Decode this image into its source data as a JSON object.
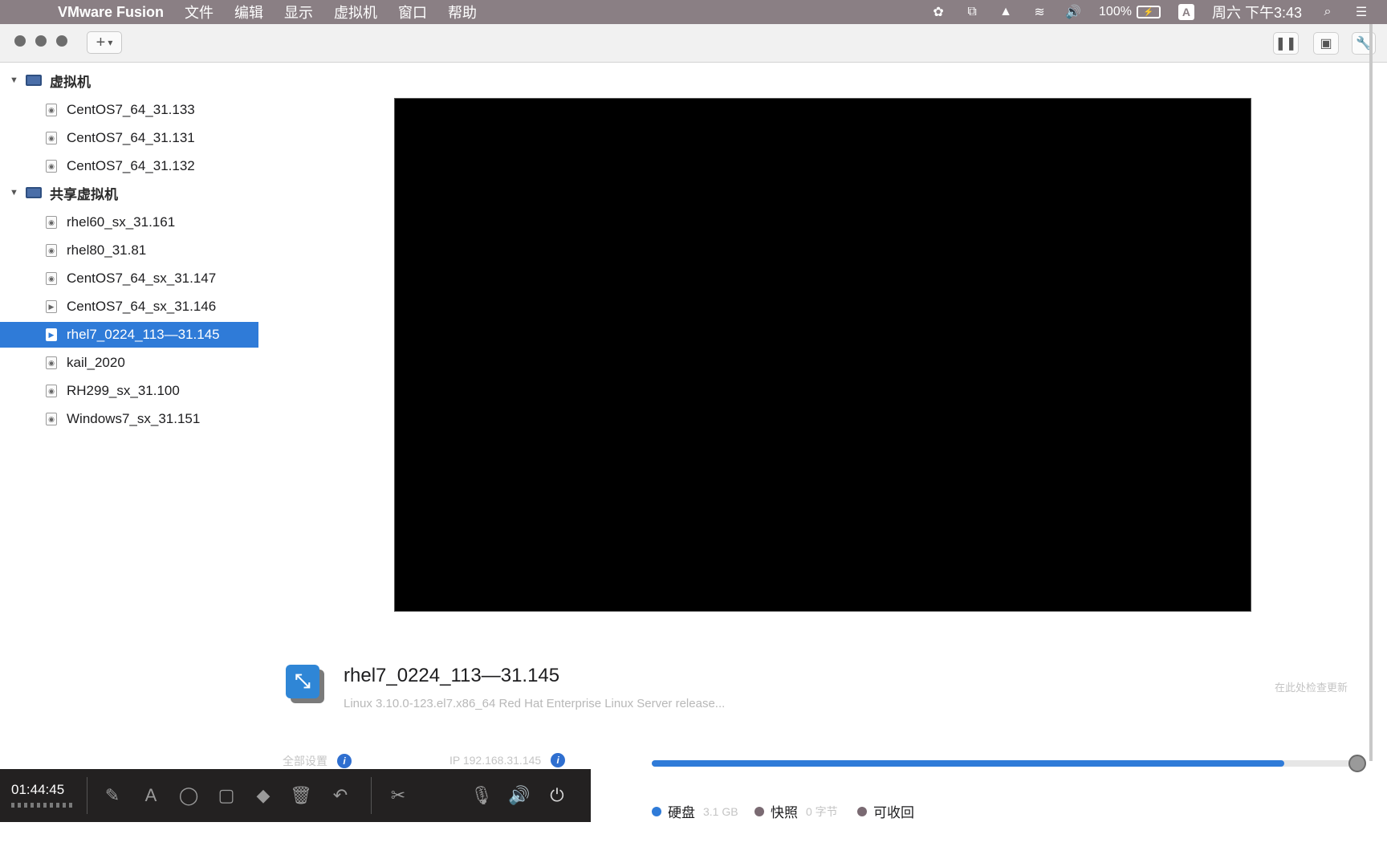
{
  "menubar": {
    "app_name": "VMware Fusion",
    "items": [
      "文件",
      "编辑",
      "显示",
      "虚拟机",
      "窗口",
      "帮助"
    ],
    "battery": "100%",
    "input_method": "A",
    "clock": "周六 下午3:43"
  },
  "sidebar": {
    "group1": {
      "label": "虚拟机",
      "items": [
        "CentOS7_64_31.133",
        "CentOS7_64_31.131",
        "CentOS7_64_31.132"
      ]
    },
    "group2": {
      "label": "共享虚拟机",
      "items": [
        "rhel60_sx_31.161",
        "rhel80_31.81",
        "CentOS7_64_sx_31.147",
        "CentOS7_64_sx_31.146",
        "rhel7_0224_113—31.145",
        "kail_2020",
        "RH299_sx_31.100",
        "Windows7_sx_31.151"
      ]
    },
    "selected": "rhel7_0224_113—31.145"
  },
  "vm_detail": {
    "title": "rhel7_0224_113—31.145",
    "description": "Linux 3.10.0-123.el7.x86_64 Red Hat Enterprise Linux Server release...",
    "right_hint": "在此处检查更新",
    "info_left": "全部设置",
    "info_mid": "IP 192.168.31.145"
  },
  "usage": {
    "fill_fraction": 0.9,
    "legend": [
      {
        "label": "硬盘",
        "value": "3.1 GB",
        "color": "#2f7bd8"
      },
      {
        "label": "快照",
        "value": "0 字节",
        "color": "#7a6a72"
      },
      {
        "label": "可收回",
        "value": "",
        "color": "#7a6a72"
      }
    ]
  },
  "recorder": {
    "time": "01:44:45"
  }
}
